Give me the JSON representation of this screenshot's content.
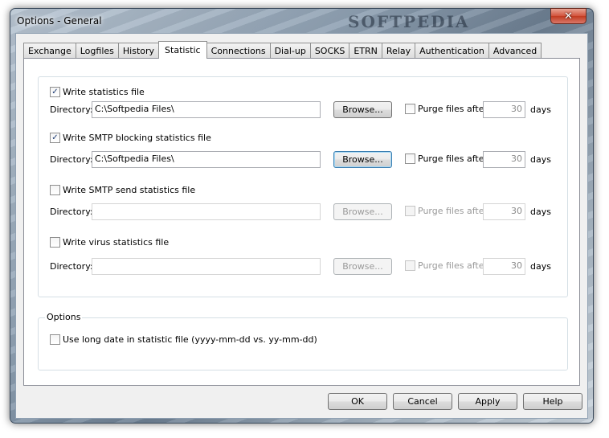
{
  "window": {
    "title": "Options - General",
    "watermark": "SOFTPEDIA",
    "close_glyph": "✕"
  },
  "tabs": [
    {
      "label": "Exchange",
      "active": false
    },
    {
      "label": "Logfiles",
      "active": false
    },
    {
      "label": "History",
      "active": false
    },
    {
      "label": "Statistic",
      "active": true
    },
    {
      "label": "Connections",
      "active": false
    },
    {
      "label": "Dial-up",
      "active": false
    },
    {
      "label": "SOCKS",
      "active": false
    },
    {
      "label": "ETRN",
      "active": false
    },
    {
      "label": "Relay",
      "active": false
    },
    {
      "label": "Authentication",
      "active": false
    },
    {
      "label": "Advanced",
      "active": false
    }
  ],
  "stats": [
    {
      "label": "Write statistics file",
      "checked": true,
      "directory_label": "Directory:",
      "directory": "C:\\Softpedia Files\\",
      "browse": "Browse...",
      "purge_label": "Purge files after",
      "purge_checked": false,
      "days_value": "30",
      "days_label": "days",
      "enabled": true
    },
    {
      "label": "Write SMTP blocking statistics file",
      "checked": true,
      "directory_label": "Directory:",
      "directory": "C:\\Softpedia Files\\",
      "browse": "Browse...",
      "purge_label": "Purge files after",
      "purge_checked": false,
      "days_value": "30",
      "days_label": "days",
      "enabled": true
    },
    {
      "label": "Write SMTP send statistics file",
      "checked": false,
      "directory_label": "Directory:",
      "directory": "",
      "browse": "Browse...",
      "purge_label": "Purge files after",
      "purge_checked": false,
      "days_value": "30",
      "days_label": "days",
      "enabled": false
    },
    {
      "label": "Write virus statistics file",
      "checked": false,
      "directory_label": "Directory:",
      "directory": "",
      "browse": "Browse...",
      "purge_label": "Purge files after",
      "purge_checked": false,
      "days_value": "30",
      "days_label": "days",
      "enabled": false
    }
  ],
  "options": {
    "title": "Options",
    "long_date_label": "Use long date in statistic file (yyyy-mm-dd vs. yy-mm-dd)",
    "long_date_checked": false
  },
  "buttons": {
    "ok": "OK",
    "cancel": "Cancel",
    "apply": "Apply",
    "help": "Help"
  },
  "check_glyph": "✓"
}
